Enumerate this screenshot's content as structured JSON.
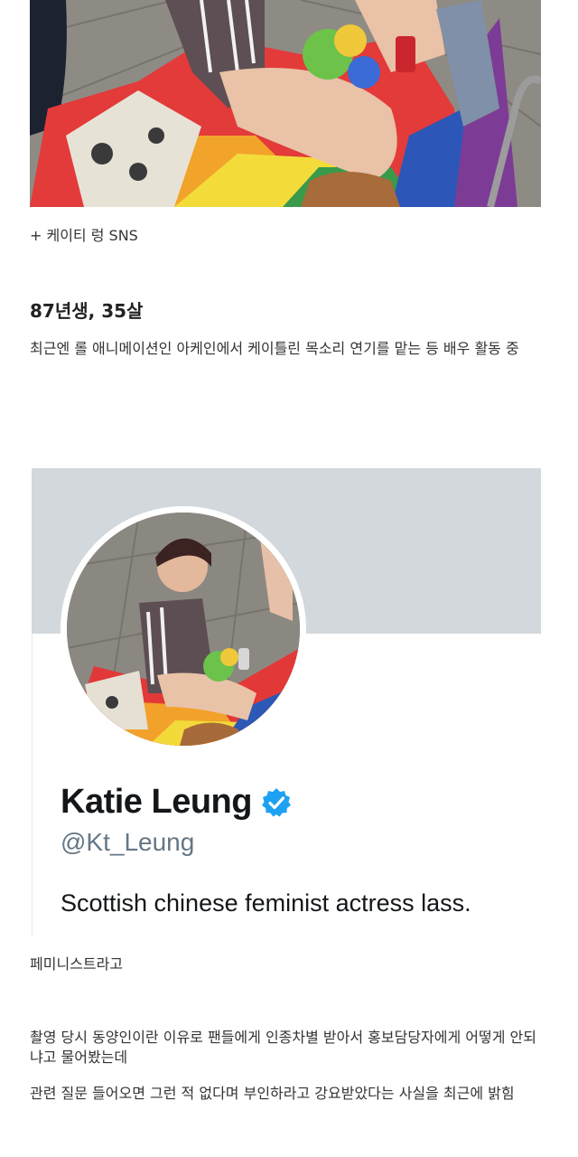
{
  "post": {
    "caption": "+ 케이티 렁 SNS",
    "heading": "87년생, 35살",
    "intro": "최근엔 롤 애니메이션인 아케인에서 케이틀린 목소리 연기를 맡는 등 배우 활동 중",
    "feminist_line": "페미니스트라고",
    "para_incident": "촬영 당시 동양인이란 이유로 팬들에게 인종차별 받아서 홍보담당자에게 어떻게 안되냐고 물어봤는데",
    "para_forced": "관련 질문 들어오면 그런 적 없다며 부인하라고 강요받았다는 사실을 최근에 밝힘"
  },
  "profile_card": {
    "name": "Katie Leung",
    "handle": "@Kt_Leung",
    "bio": "Scottish chinese feminist actress lass.",
    "verified_icon": "verified-badge-icon",
    "colors": {
      "banner": "#d3d8dc",
      "verified": "#1da1f2",
      "handle": "#657786",
      "name": "#14171a"
    }
  }
}
